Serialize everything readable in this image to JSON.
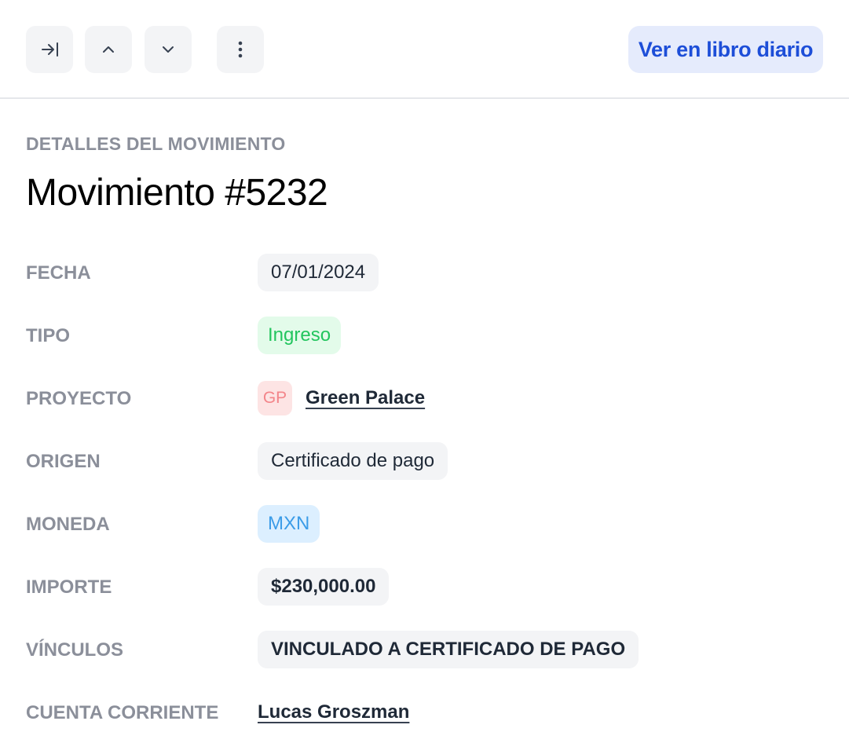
{
  "toolbar": {
    "buttons": [
      {
        "name": "collapse-panel-button",
        "icon": "arrow-right-to-line-icon"
      },
      {
        "name": "previous-button",
        "icon": "chevron-up-icon"
      },
      {
        "name": "next-button",
        "icon": "chevron-down-icon"
      },
      {
        "name": "more-options-button",
        "icon": "more-vertical-icon"
      }
    ],
    "journal_label": "Ver en libro diario"
  },
  "header": {
    "eyebrow": "DETALLES DEL MOVIMIENTO",
    "title": "Movimiento #5232"
  },
  "details": {
    "fecha": {
      "label": "FECHA",
      "value": "07/01/2024"
    },
    "tipo": {
      "label": "TIPO",
      "value": "Ingreso"
    },
    "proyecto": {
      "label": "PROYECTO",
      "initials": "GP",
      "value": "Green Palace"
    },
    "origen": {
      "label": "ORIGEN",
      "value": "Certificado de pago"
    },
    "moneda": {
      "label": "MONEDA",
      "value": "MXN"
    },
    "importe": {
      "label": "IMPORTE",
      "value": "$230,000.00"
    },
    "vinculos": {
      "label": "VÍNCULOS",
      "value": "VINCULADO A CERTIFICADO DE PAGO"
    },
    "cuenta": {
      "label": "CUENTA CORRIENTE",
      "value": "Lucas Groszman"
    }
  },
  "colors": {
    "accent": "#1d4ed8",
    "income": "#22c55e",
    "currency": "#3b9ce8",
    "project_avatar": "#f3858a"
  }
}
